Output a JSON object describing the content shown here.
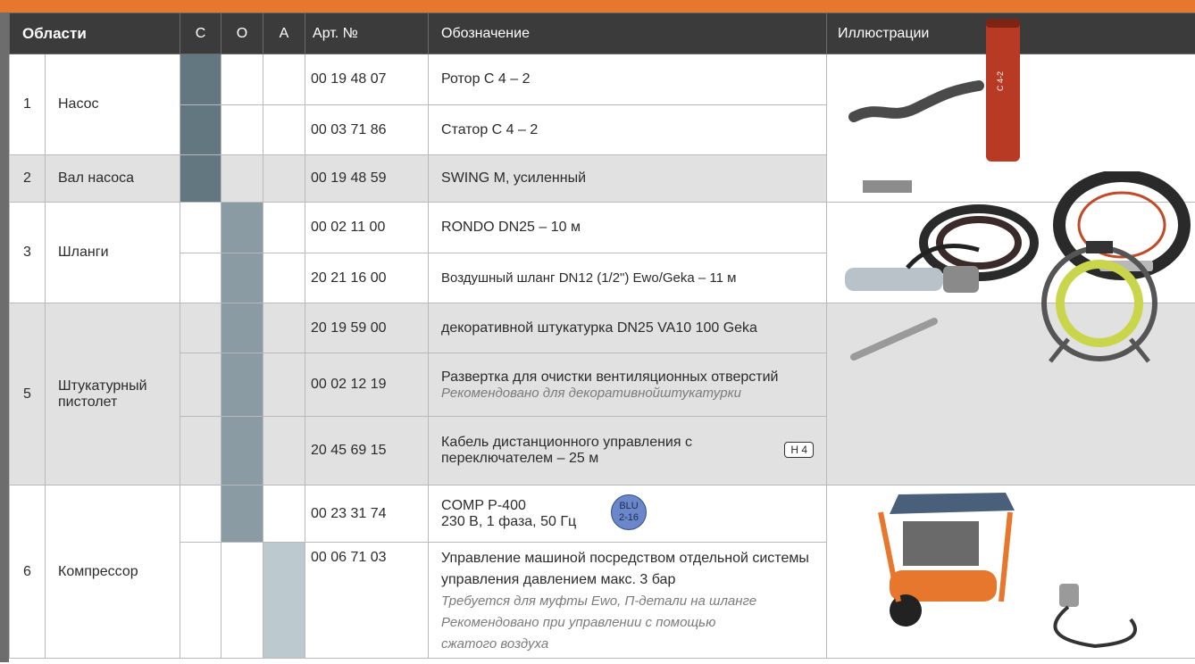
{
  "header": {
    "area": "Области",
    "c": "C",
    "o": "O",
    "a": "A",
    "art": "Арт. №",
    "desc": "Обозначение",
    "illus": "Иллюстрации"
  },
  "rows": {
    "r1": {
      "num": "1",
      "name": "Насос",
      "art1": "00 19 48 07",
      "desc1": "Ротор C 4 – 2",
      "art2": "00 03 71 86",
      "desc2": "Статор C 4 – 2"
    },
    "r2": {
      "num": "2",
      "name": "Вал насоса",
      "art": "00 19 48 59",
      "desc": "SWING M, усиленный"
    },
    "r3": {
      "num": "3",
      "name": "Шланги",
      "art1": "00 02 11 00",
      "desc1": "RONDO DN25 – 10 м",
      "art2": "20 21 16 00",
      "desc2": "Воздушный шланг DN12 (1/2\") Ewo/Geka – 11 м"
    },
    "r5": {
      "num": "5",
      "name": "Штукатурный пистолет",
      "art1": "20 19 59 00",
      "desc1": "декоративной штукатурка DN25 VA10 100 Geka",
      "art2": "00 02 12 19",
      "desc2": "Развертка для очистки вентиляционных отверстий",
      "note2": "Рекомендовано для декоративнойштукатурки",
      "art3": "20 45 69 15",
      "desc3": "Кабель дистанционного управления с переключателем – 25 м",
      "badge3": "H 4"
    },
    "r6": {
      "num": "6",
      "name": "Компрессор",
      "art1": "00 23 31 74",
      "desc1a": "COMP P-400",
      "desc1b": "230 В, 1 фаза, 50 Гц",
      "badge1a": "BLU",
      "badge1b": "2-16",
      "art2": "00 06 71 03",
      "desc2": "Управление машиной посредством отдельной системы управления давлением макс. 3 бар",
      "note2a": "Требуется для муфты Ewo, П-детали на шланге",
      "note2b": "Рекомендовано при управлении с помощью",
      "note2c": "сжатого воздуха"
    }
  },
  "illustration_labels": {
    "stator_label": "C 4-2"
  },
  "colors": {
    "top_bar": "#e8772e",
    "header_bg": "#3b3b3b",
    "c_fill": "#637781",
    "o_fill": "#8a9ba4",
    "a_fill": "#bcc9cf",
    "row_grey": "#e1e1e1"
  }
}
